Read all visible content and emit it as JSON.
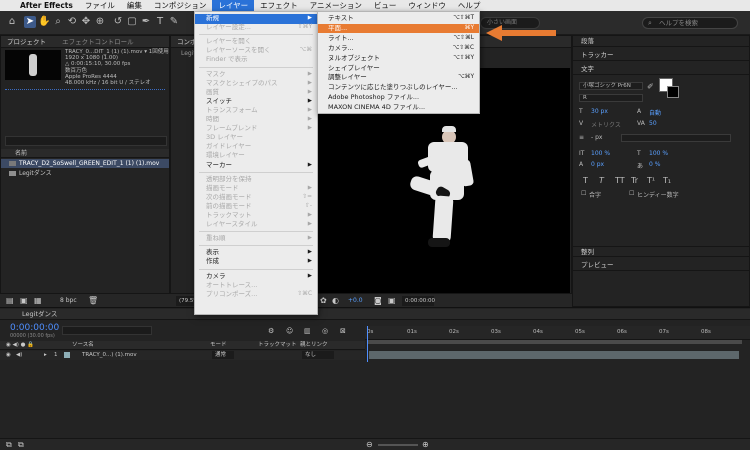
{
  "menubar": {
    "apple": "",
    "items": [
      "After Effects",
      "ファイル",
      "編集",
      "コンポジション",
      "レイヤー",
      "エフェクト",
      "アニメーション",
      "ビュー",
      "ウィンドウ",
      "ヘルプ"
    ],
    "active_index": 4
  },
  "toolbar": {
    "search_help_placeholder": "ヘルプを検索",
    "search_comp_placeholder": "小さい画面"
  },
  "project": {
    "tab_label": "プロジェクト",
    "effects_tab": "エフェクトコントロール",
    "info_lines": [
      "TRACY_0...DIT_1 (1) (1).mov ▾ 1回使用",
      "1920 x 1080 (1.00)",
      "△ 0:00:15:10, 30.00 fps",
      "数百万色",
      "Apple ProRes 4444",
      "48.000 kHz / 16 bit U / ステレオ"
    ],
    "header_name": "名前",
    "items": [
      "TRACY_D2_SoSwell_GREEN_EDIT_1 (1) (1).mov",
      "Legitダンス"
    ],
    "bpc": "8 bpc"
  },
  "comp": {
    "tab_label": "コンポジション Legitダンス",
    "tab_short": "Legit",
    "zoom": "(79.5%)",
    "offset": "+0.0",
    "time": "0:00:00:00"
  },
  "layer_menu": [
    {
      "label": "新規",
      "shortcut": "",
      "submenu": true,
      "disabled": false,
      "highlight": true
    },
    {
      "label": "レイヤー設定...",
      "shortcut": "⇧⌘Y",
      "disabled": true
    },
    {
      "sep": true
    },
    {
      "label": "レイヤーを開く",
      "shortcut": "",
      "disabled": true
    },
    {
      "label": "レイヤーソースを開く",
      "shortcut": "⌥⌘",
      "disabled": true
    },
    {
      "label": "Finder で表示",
      "shortcut": "",
      "disabled": true
    },
    {
      "sep": true
    },
    {
      "label": "マスク",
      "submenu": true,
      "disabled": true
    },
    {
      "label": "マスクとシェイプのパス",
      "submenu": true,
      "disabled": true
    },
    {
      "label": "画質",
      "submenu": true,
      "disabled": true
    },
    {
      "label": "スイッチ",
      "submenu": true,
      "disabled": false
    },
    {
      "label": "トランスフォーム",
      "submenu": true,
      "disabled": true
    },
    {
      "label": "時間",
      "submenu": true,
      "disabled": true
    },
    {
      "label": "フレームブレンド",
      "submenu": true,
      "disabled": true
    },
    {
      "label": "3D レイヤー",
      "disabled": true
    },
    {
      "label": "ガイドレイヤー",
      "disabled": true
    },
    {
      "label": "環境レイヤー",
      "disabled": true
    },
    {
      "label": "マーカー",
      "submenu": true,
      "disabled": false
    },
    {
      "sep": true
    },
    {
      "label": "透明部分を保持",
      "disabled": true
    },
    {
      "label": "描画モード",
      "submenu": true,
      "disabled": true
    },
    {
      "label": "次の描画モード",
      "shortcut": "⇧=",
      "disabled": true
    },
    {
      "label": "前の描画モード",
      "shortcut": "⇧-",
      "disabled": true
    },
    {
      "label": "トラックマット",
      "submenu": true,
      "disabled": true
    },
    {
      "label": "レイヤースタイル",
      "submenu": true,
      "disabled": true
    },
    {
      "sep": true
    },
    {
      "label": "重ね順",
      "submenu": true,
      "disabled": true
    },
    {
      "sep": true
    },
    {
      "label": "表示",
      "submenu": true,
      "disabled": false
    },
    {
      "label": "作成",
      "submenu": true,
      "disabled": false
    },
    {
      "sep": true
    },
    {
      "label": "カメラ",
      "submenu": true,
      "disabled": false
    },
    {
      "label": "オートトレース...",
      "disabled": true
    },
    {
      "label": "プリコンポーズ...",
      "shortcut": "⇧⌘C",
      "disabled": true
    }
  ],
  "new_submenu": [
    {
      "label": "テキスト",
      "shortcut": "⌥⇧⌘T"
    },
    {
      "label": "平面...",
      "shortcut": "⌘Y",
      "highlight": true
    },
    {
      "label": "ライト...",
      "shortcut": "⌥⇧⌘L"
    },
    {
      "label": "カメラ...",
      "shortcut": "⌥⇧⌘C"
    },
    {
      "label": "ヌルオブジェクト",
      "shortcut": "⌥⇧⌘Y"
    },
    {
      "label": "シェイプレイヤー",
      "shortcut": ""
    },
    {
      "label": "調整レイヤー",
      "shortcut": "⌥⌘Y"
    },
    {
      "label": "コンテンツに応じた塗りつぶしのレイヤー...",
      "shortcut": ""
    },
    {
      "label": "Adobe Photoshop ファイル...",
      "shortcut": ""
    },
    {
      "label": "MAXON CINEMA 4D ファイル...",
      "shortcut": ""
    }
  ],
  "right_panel": {
    "sections": [
      "段落",
      "トラッカー",
      "文字"
    ],
    "font_name": "小塚ゴシック Pr6N",
    "font_style": "R",
    "font_size": "30 px",
    "leading": "自動",
    "kerning": "メトリクス",
    "tracking": "50",
    "stroke": "- px",
    "vscale": "100 %",
    "hscale": "100 %",
    "baseline": "0 px",
    "tsume": "0 %",
    "type_buttons": [
      "T",
      "T",
      "TT",
      "Tr",
      "T¹",
      "T₁"
    ],
    "checkbox_1": "合字",
    "checkbox_2": "ヒンディー数字",
    "bottom_sections": [
      "整列",
      "プレビュー"
    ]
  },
  "timeline": {
    "tab_label": "Legitダンス",
    "time": "0:00:00:00",
    "fps": "00000 (30.00 fps)",
    "ruler_labels": [
      "0s",
      "01s",
      "02s",
      "03s",
      "04s",
      "05s",
      "06s",
      "07s",
      "08s"
    ],
    "header": {
      "source": "ソース名",
      "mode": "モード",
      "trkmat": "トラックマット",
      "parent": "親とリンク"
    },
    "row": {
      "index": "1",
      "name": "TRACY_0...) (1).mov",
      "mode": "通常",
      "parent": "なし"
    }
  },
  "colors": {
    "menu_highlight": "#2a72d8",
    "submenu_highlight": "#e87b32",
    "annotation_arrow": "#e87b32",
    "time_blue": "#4f8fff"
  }
}
